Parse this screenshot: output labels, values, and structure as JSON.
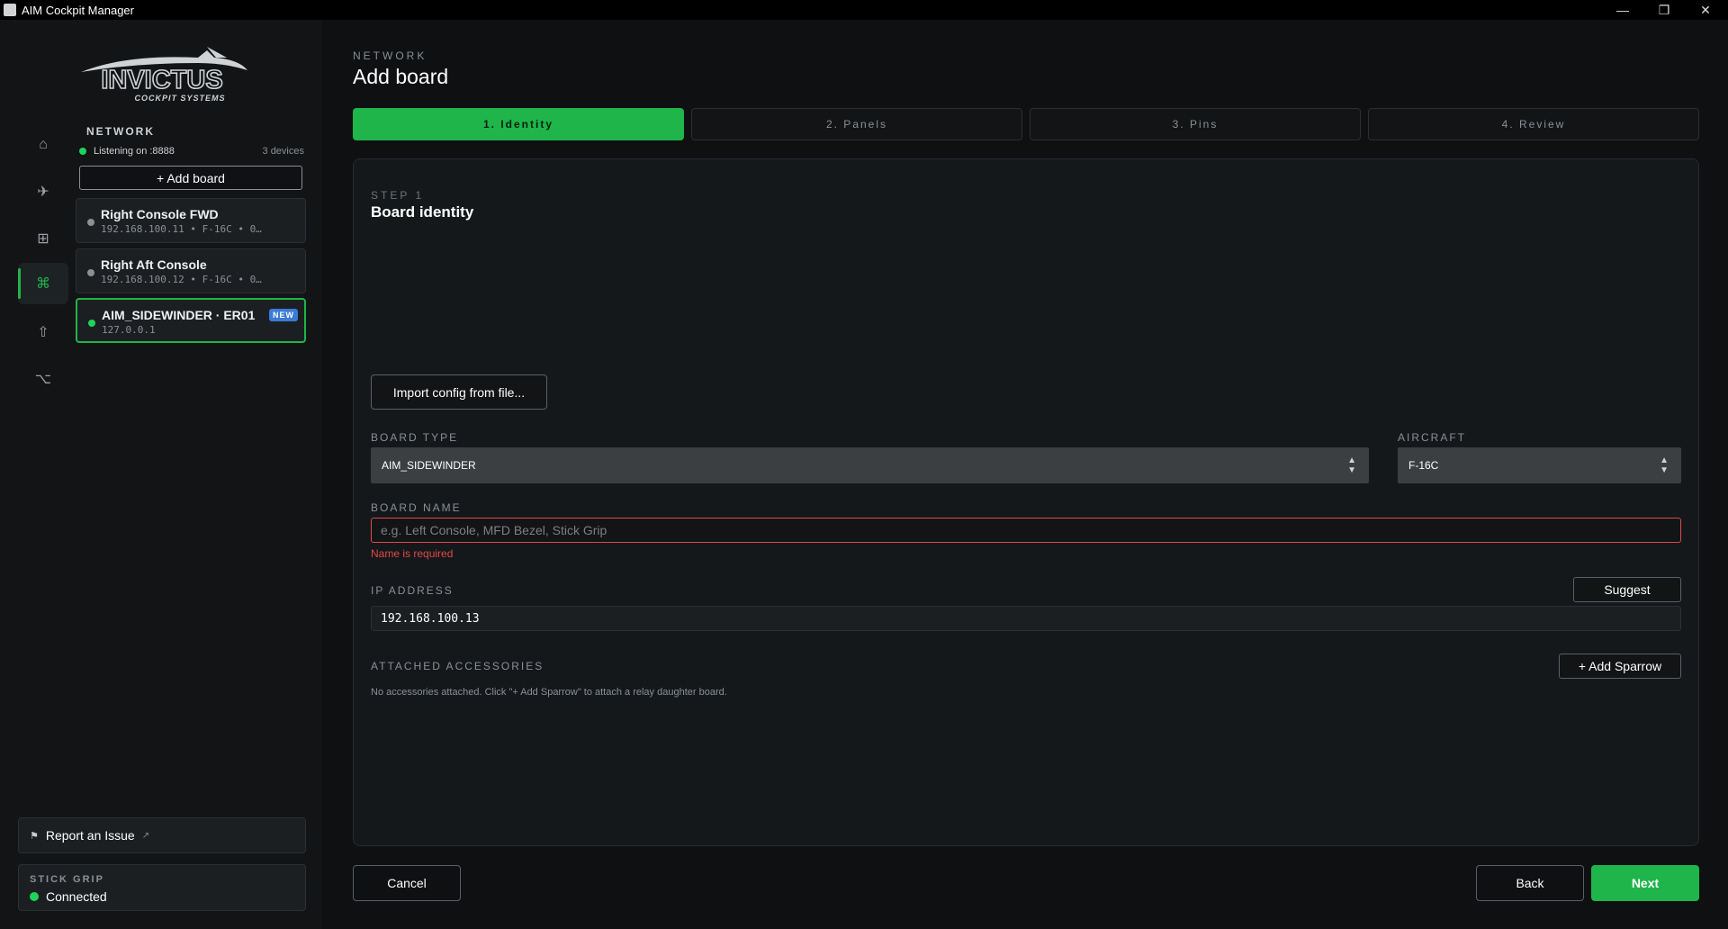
{
  "window": {
    "title": "AIM Cockpit Manager"
  },
  "logo": {
    "brand": "INVICTUS",
    "tagline": "COCKPIT SYSTEMS"
  },
  "sidebar": {
    "section_title": "NETWORK",
    "listening": "Listening on :8888",
    "device_count": "3 devices",
    "add_board_label": "+ Add board",
    "boards": [
      {
        "name": "Right Console FWD",
        "meta": "192.168.100.11  •  F-16C  •  0…",
        "status": "offline"
      },
      {
        "name": "Right Aft Console",
        "meta": "192.168.100.12  •  F-16C  •  0…",
        "status": "offline"
      },
      {
        "name": "AIM_SIDEWINDER · ER01",
        "meta": "127.0.0.1",
        "status": "online",
        "badge": "NEW"
      }
    ],
    "report_issue": "Report an Issue",
    "stick_grip": {
      "label": "STICK GRIP",
      "state": "Connected"
    }
  },
  "header": {
    "crumb": "NETWORK",
    "title": "Add board"
  },
  "steps": [
    "1. Identity",
    "2. Panels",
    "3. Pins",
    "4. Review"
  ],
  "form": {
    "step_label": "STEP 1",
    "step_title": "Board identity",
    "import_label": "Import config from file...",
    "board_type": {
      "label": "BOARD TYPE",
      "value": "AIM_SIDEWINDER"
    },
    "aircraft": {
      "label": "AIRCRAFT",
      "value": "F-16C"
    },
    "board_name": {
      "label": "BOARD NAME",
      "placeholder": "e.g. Left Console, MFD Bezel, Stick Grip",
      "value": "",
      "error": "Name is required"
    },
    "ip_address": {
      "label": "IP ADDRESS",
      "value": "192.168.100.13",
      "suggest_label": "Suggest"
    },
    "accessories": {
      "label": "ATTACHED ACCESSORIES",
      "add_label": "+ Add Sparrow",
      "empty_note": "No accessories attached. Click \"+ Add Sparrow\" to attach a relay daughter board."
    }
  },
  "footer": {
    "cancel": "Cancel",
    "back": "Back",
    "next": "Next"
  },
  "colors": {
    "accent": "#1fb54a",
    "error": "#d94a4a",
    "badge": "#3a7bd5"
  }
}
